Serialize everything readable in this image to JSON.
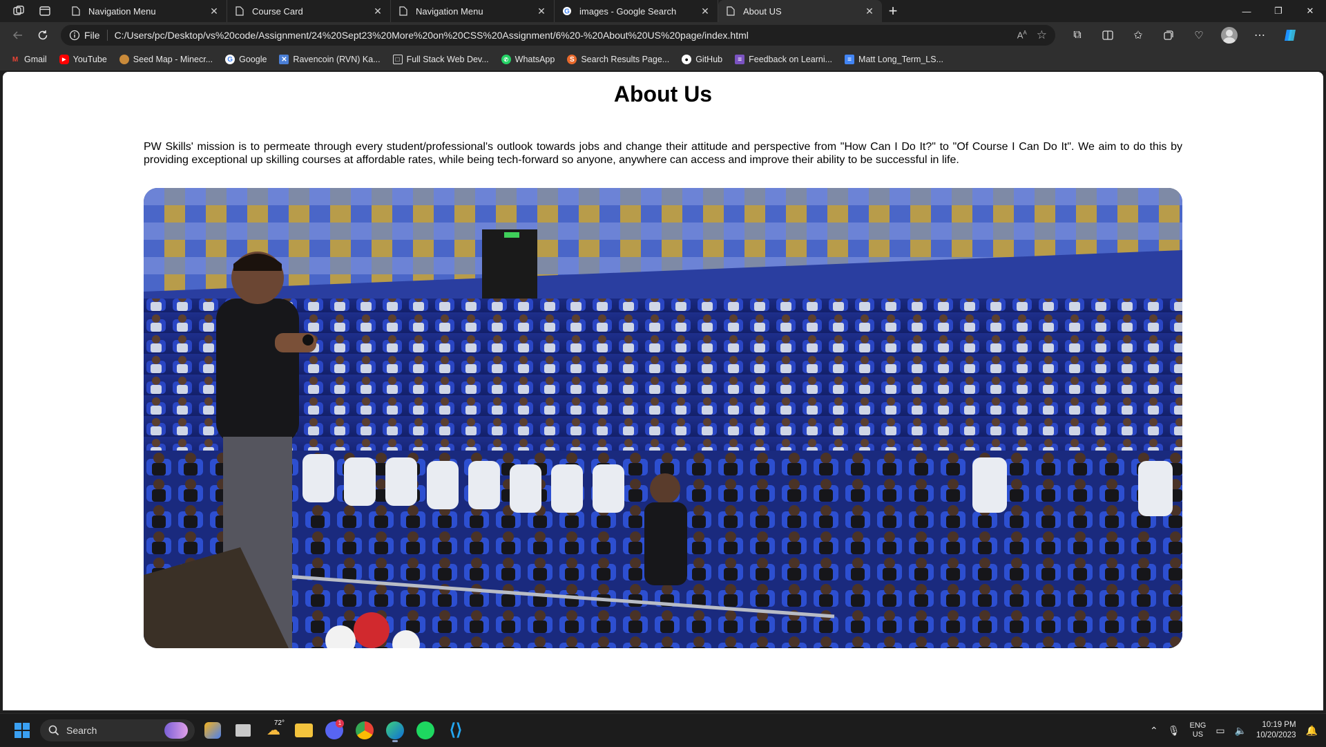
{
  "browser": {
    "tabs": [
      {
        "title": "Navigation Menu",
        "icon": "page-icon",
        "active": false
      },
      {
        "title": "Course Card",
        "icon": "page-icon",
        "active": false
      },
      {
        "title": "Navigation Menu",
        "icon": "page-icon",
        "active": false
      },
      {
        "title": "images - Google Search",
        "icon": "google-icon",
        "active": false
      },
      {
        "title": "About US",
        "icon": "page-icon",
        "active": true
      }
    ],
    "address": {
      "scheme_label": "File",
      "url": "C:/Users/pc/Desktop/vs%20code/Assignment/24%20Sept23%20More%20on%20CSS%20Assignment/6%20-%20About%20US%20page/index.html"
    },
    "bookmarks": [
      {
        "label": "Gmail",
        "icon": "gmail-icon",
        "color": "#ea4335"
      },
      {
        "label": "YouTube",
        "icon": "youtube-icon",
        "color": "#ff0000"
      },
      {
        "label": "Seed Map - Minecr...",
        "icon": "seedmap-icon",
        "color": "#c98a3a"
      },
      {
        "label": "Google",
        "icon": "google-icon",
        "color": "#ffffff"
      },
      {
        "label": "Ravencoin (RVN) Ka...",
        "icon": "ravencoin-icon",
        "color": "#4b7fd6"
      },
      {
        "label": "Full Stack Web Dev...",
        "icon": "fullstack-icon",
        "color": "#dddddd"
      },
      {
        "label": "WhatsApp",
        "icon": "whatsapp-icon",
        "color": "#25d366"
      },
      {
        "label": "Search Results Page...",
        "icon": "search-results-icon",
        "color": "#e8692c"
      },
      {
        "label": "GitHub",
        "icon": "github-icon",
        "color": "#ffffff"
      },
      {
        "label": "Feedback on Learni...",
        "icon": "forms-icon",
        "color": "#7b53c1"
      },
      {
        "label": "Matt Long_Term_LS...",
        "icon": "docs-icon",
        "color": "#4285f4"
      }
    ]
  },
  "page": {
    "title": "About Us",
    "mission": "PW Skills' mission is to permeate through every student/professional's outlook towards jobs and change their attitude and perspective from \"How Can I Do It?\" to \"Of Course I Can Do It\". We aim to do this by providing exceptional up skilling courses at affordable rates, while being tech-forward so anyone, anywhere can access and improve their ability to be successful in life."
  },
  "taskbar": {
    "search_label": "Search",
    "weather": "72°",
    "discord_badge": "1",
    "language": {
      "line1": "ENG",
      "line2": "US"
    },
    "time": "10:19 PM",
    "date": "10/20/2023"
  }
}
